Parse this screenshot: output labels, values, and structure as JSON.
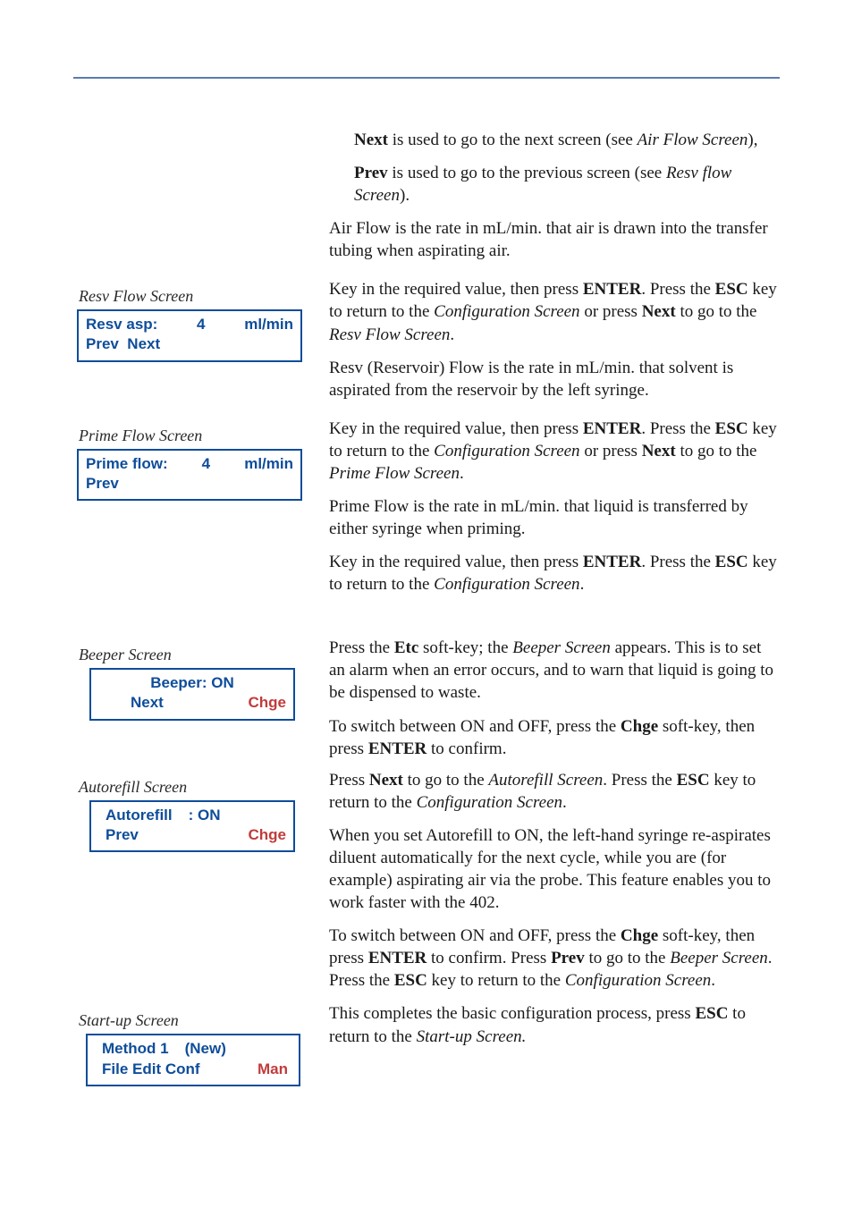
{
  "intro": {
    "next_line": "Next is used to go to the next screen (see Air Flow Screen),",
    "next_bold": "Next",
    "next_after_bold": " is used to go to the next screen (see ",
    "next_em": "Air Flow Screen",
    "next_tail": "),",
    "prev_bold": "Prev",
    "prev_after_bold": " is used to go to the previous screen (see ",
    "prev_em": "Resv flow Screen",
    "prev_tail": ")."
  },
  "airflow_para": "Air Flow is the rate in mL/min. that air is drawn into the transfer tubing when aspirating air.",
  "resv": {
    "caption": "Resv Flow Screen",
    "lcd": {
      "line1_l": "Resv asp:",
      "line1_m": "4",
      "line1_r": "ml/min",
      "line2": "Prev  Next"
    },
    "p1_a": "Key in the required value, then press ",
    "p1_b": "ENTER",
    "p1_c": ". Press the ",
    "p1_d": "ESC",
    "p1_e": " key to return to the ",
    "p1_f": "Configuration Screen",
    "p1_g": " or press ",
    "p1_h": "Next",
    "p1_i": " to go to the ",
    "p1_j": "Resv Flow Screen",
    "p1_k": ".",
    "p2": "Resv (Reservoir) Flow is the rate in mL/min. that solvent is aspirated from the reservoir by the left syringe."
  },
  "prime": {
    "caption": "Prime Flow Screen",
    "lcd": {
      "line1_l": "Prime flow:",
      "line1_m": "4",
      "line1_r": "ml/min",
      "line2": "Prev"
    },
    "p1_a": "Key in the required value, then press ",
    "p1_b": "ENTER",
    "p1_c": ". Press the ",
    "p1_d": "ESC",
    "p1_e": " key to return to the ",
    "p1_f": "Configuration Screen",
    "p1_g": " or press ",
    "p1_h": "Next",
    "p1_i": " to go to the ",
    "p1_j": "Prime Flow Screen",
    "p1_k": ".",
    "p2": "Prime Flow is the rate in mL/min. that liquid is transferred by either syringe when priming.",
    "p3_a": "Key in the required value, then press ",
    "p3_b": "ENTER",
    "p3_c": ". Press the ",
    "p3_d": "ESC",
    "p3_e": " key to return to the ",
    "p3_f": "Configuration Screen",
    "p3_g": "."
  },
  "beeper": {
    "caption": "Beeper Screen",
    "lcd": {
      "line1": "Beeper: ON",
      "line2_l": "Next",
      "line2_r": "Chge"
    },
    "p1_a": "Press the ",
    "p1_b": "Etc",
    "p1_c": " soft-key; the ",
    "p1_d": "Beeper Screen",
    "p1_e": " appears. This is to set an alarm when an error occurs, and to warn that liquid is going to be dispensed to waste.",
    "p2_a": "To switch between ON and OFF, press the ",
    "p2_b": "Chge",
    "p2_c": " soft-key, then press ",
    "p2_d": "ENTER",
    "p2_e": " to confirm."
  },
  "autorefill": {
    "caption": "Autorefill Screen",
    "lcd": {
      "line1_l": "Autorefill",
      "line1_r": ": ON",
      "line2_l": "Prev",
      "line2_r": "Chge"
    },
    "p1_a": "Press ",
    "p1_b": "Next",
    "p1_c": " to go to the ",
    "p1_d": "Autorefill Screen",
    "p1_e": ". Press the ",
    "p1_f": "ESC",
    "p1_g": " key to return to the ",
    "p1_h": "Configuration Screen",
    "p1_i": ".",
    "p2": "When you set Autorefill to ON, the left-hand syringe re-aspirates diluent automatically for the next cycle, while you are (for example) aspirating air via the probe. This feature enables you to work faster with the 402.",
    "p3_a": "To switch between ON and OFF, press the ",
    "p3_b": "Chge",
    "p3_c": " soft-key, then press ",
    "p3_d": "ENTER",
    "p3_e": " to confirm. Press ",
    "p3_f": "Prev",
    "p3_g": " to go to the ",
    "p3_h": "Beeper Screen",
    "p3_i": ". Press the ",
    "p3_j": "ESC",
    "p3_k": " key to return to the ",
    "p3_l": "Configuration Screen",
    "p3_m": "."
  },
  "startup": {
    "caption": "Start-up Screen",
    "lcd": {
      "line1_l": "Method 1",
      "line1_r": "(New)",
      "line2_l": "File Edit Conf",
      "line2_r": "Man"
    },
    "p1_a": "This completes the basic configuration process, press ",
    "p1_b": "ESC",
    "p1_c": " to return to the ",
    "p1_d": "Start-up Screen.",
    "p1_e": ""
  }
}
